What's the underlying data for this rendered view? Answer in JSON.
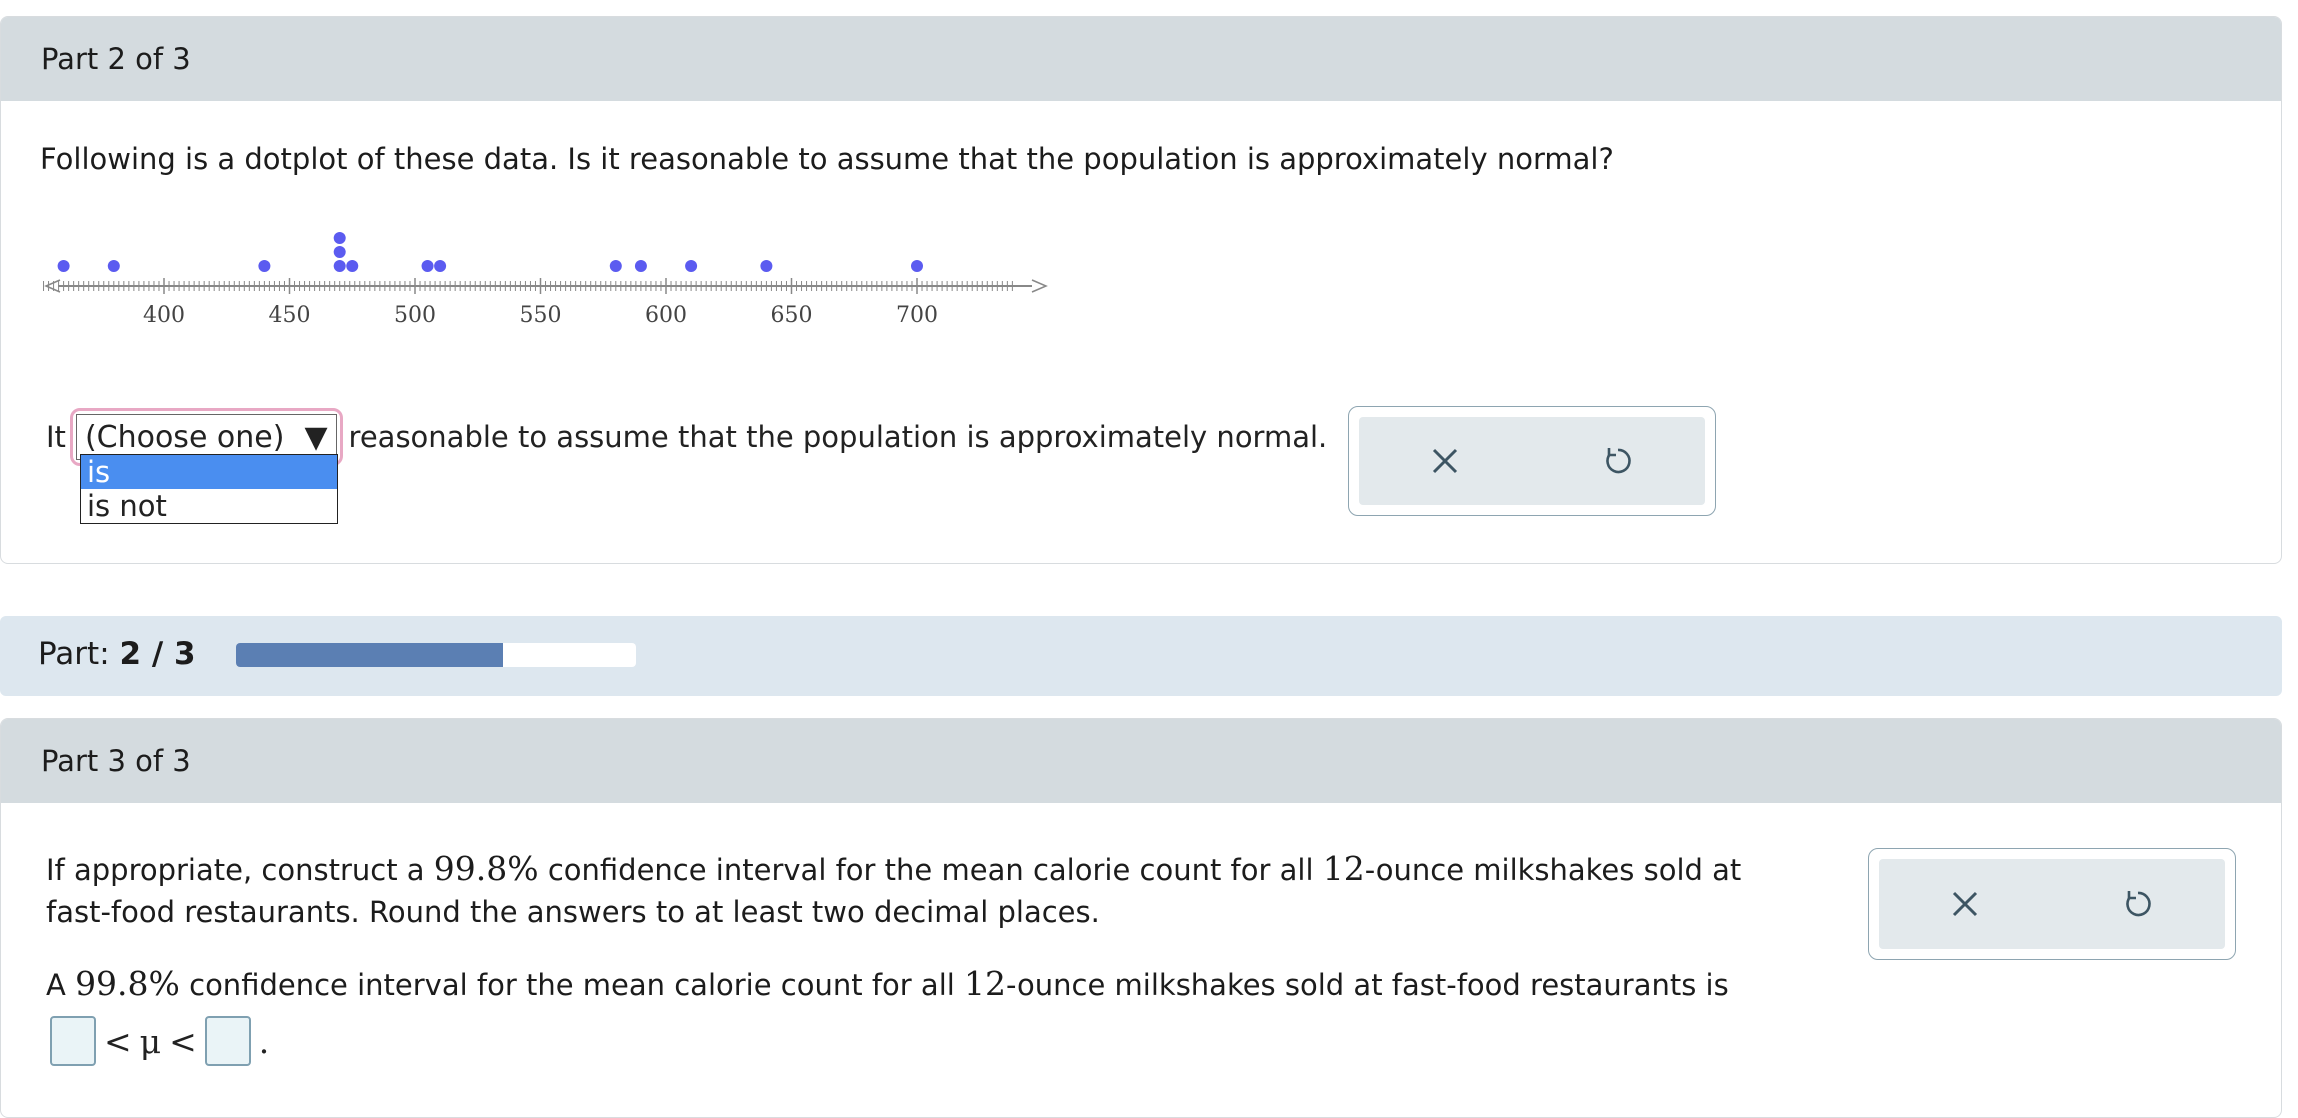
{
  "part2": {
    "header": "Part 2 of 3",
    "prompt": "Following is a dotplot of these data. Is it reasonable to assume that the population is approximately normal?",
    "sentence_before": "It",
    "select_value": "(Choose one)",
    "select_caret": "▼",
    "sentence_after": "reasonable to assume that the population is approximately normal.",
    "dropdown_options": [
      "is",
      "is not"
    ],
    "dropdown_selected": "is",
    "tools": {
      "clear_icon": "close-icon",
      "undo_icon": "undo-icon"
    }
  },
  "chart_data": {
    "type": "scatter",
    "kind": "dotplot",
    "x": [
      360,
      380,
      440,
      470,
      470,
      470,
      475,
      505,
      510,
      580,
      590,
      610,
      640,
      700
    ],
    "xlim": [
      350,
      750
    ],
    "ticks": [
      400,
      450,
      500,
      550,
      600,
      650,
      700
    ],
    "color": "#5b5bf0"
  },
  "progress": {
    "label": "Part:",
    "value": "2 / 3",
    "fraction": 0.667
  },
  "part3": {
    "header": "Part 3 of 3",
    "q_1": "If appropriate, construct a ",
    "q_conf": "99.8%",
    "q_2": " confidence interval for the mean calorie count for all ",
    "q_oz": "12",
    "q_3": "-ounce milkshakes sold at fast-food restaurants. Round the answers to at least two decimal places.",
    "a_1": "A ",
    "a_conf": "99.8%",
    "a_2": " confidence interval for the mean calorie count for all ",
    "a_oz": "12",
    "a_3": "-ounce milkshakes sold at fast-food restaurants is",
    "lt1": "<",
    "mu": "μ",
    "lt2": "<",
    "period": "."
  }
}
